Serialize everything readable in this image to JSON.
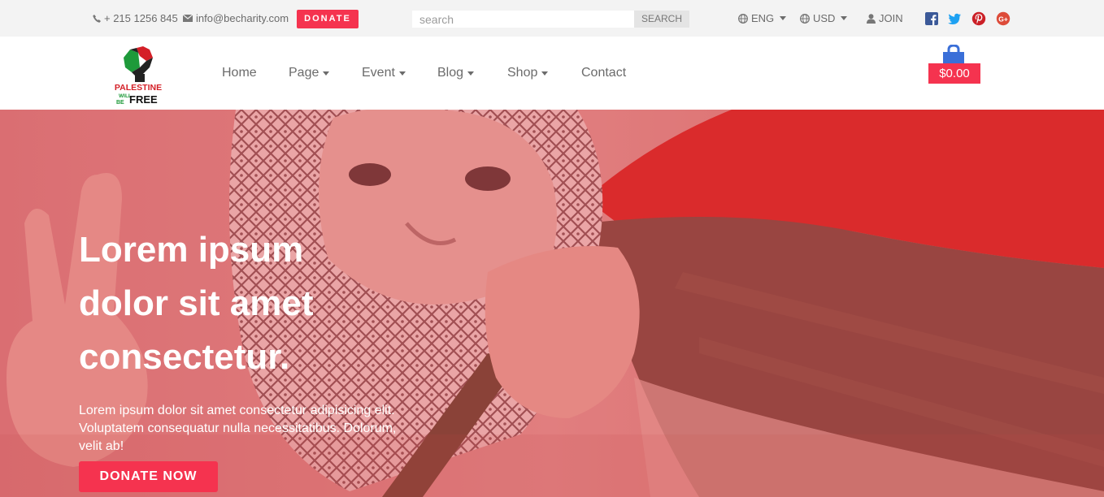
{
  "topbar": {
    "phone": "+ 215 1256 845",
    "email": "info@becharity.com",
    "donate_label": "DONATE",
    "search_placeholder": "search",
    "search_button": "SEARCH",
    "language": "ENG",
    "currency": "USD",
    "join_label": "JOIN",
    "social": [
      "facebook-icon",
      "twitter-icon",
      "pinterest-icon",
      "google-plus-icon"
    ]
  },
  "logo": {
    "line1": "PALESTINE",
    "line2a": "WILL",
    "line2b": "BE",
    "line3": "FREE"
  },
  "nav": {
    "items": [
      {
        "label": "Home",
        "dropdown": false
      },
      {
        "label": "Page",
        "dropdown": true
      },
      {
        "label": "Event",
        "dropdown": true
      },
      {
        "label": "Blog",
        "dropdown": true
      },
      {
        "label": "Shop",
        "dropdown": true
      },
      {
        "label": "Contact",
        "dropdown": false
      }
    ],
    "cart_total": "$0.00"
  },
  "hero": {
    "title_lines": [
      "Lorem ipsum",
      "dolor sit amet",
      "consectetur."
    ],
    "text": "Lorem ipsum dolor sit amet consectetur adipisicing elit. Voluptatem consequatur nulla necessitatibus. Dolorum, velit ab!",
    "button": "DONATE NOW"
  },
  "colors": {
    "accent": "#f5334f",
    "topbar_bg": "#f3f3f3",
    "overlay": "#e0585f",
    "flag_red": "#d81a1a",
    "flag_green": "#7a3a32"
  }
}
